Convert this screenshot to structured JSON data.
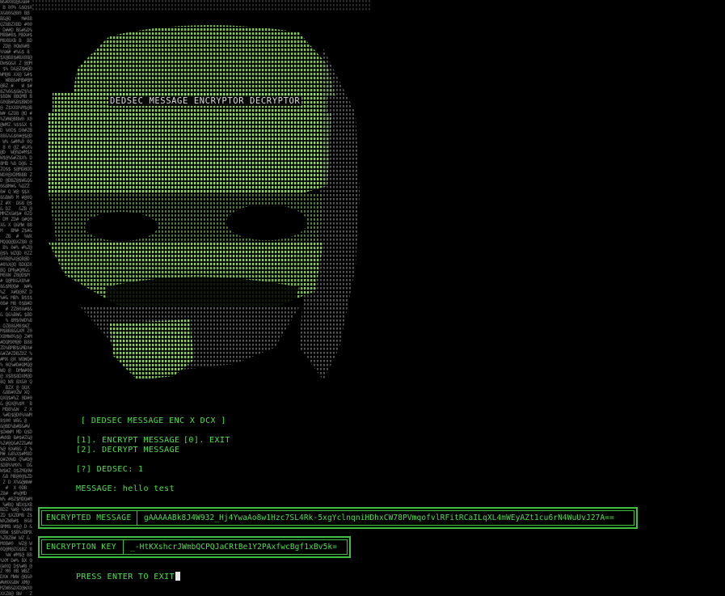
{
  "banner": {
    "title": "DEDSEC MESSAGE ENCRYPTOR DECRYPTOR"
  },
  "menu": {
    "header": "[ DEDSEC MESSAGE ENC X DCX ]",
    "option_1": "[1]. ENCRYPT MESSAGE",
    "option_exit": "[0]. EXIT",
    "option_2": "[2]. DECRYPT MESSAGE",
    "prompt": "[?] DEDSEC: 1",
    "message_line": "MESSAGE: hello test"
  },
  "encrypted_box": {
    "label": "ENCRYPTED MESSAGE",
    "value": "gAAAAABk8J4W932_Hj4YwaAo8w1Hzc7SL4Rk-5xgYclnqniHDhxCW78PVmqofvlRFitRCaILqXL4mWEyAZt1cu6rN4WuUvJ27A=="
  },
  "key_box": {
    "label": "ENCRYPTION KEY",
    "value": "_-HtKXshcrJWmbQCPQJaCRtBe1Y2PAxfwcBgf1xBv5k="
  },
  "exit_prompt": "PRESS ENTER TO EXIT",
  "colors": {
    "terminal_bg": "#000000",
    "text_green": "#4fe04f",
    "art_green": "#9be36b",
    "art_gray": "#8a8a8a",
    "cursor": "#e6e6e6"
  },
  "icons": {
    "cursor": "block-cursor-icon"
  }
}
